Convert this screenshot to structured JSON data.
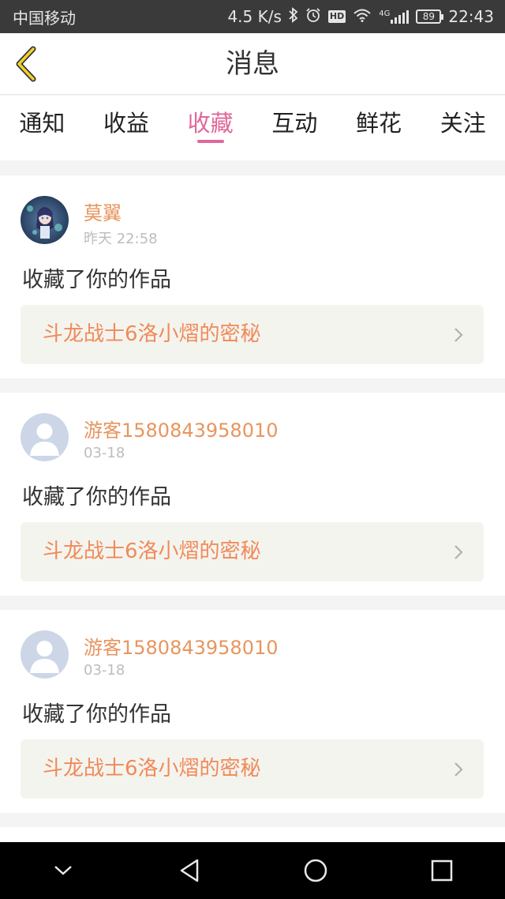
{
  "status_bar": {
    "carrier": "中国移动",
    "net_speed": "4.5 K/s",
    "battery": "89",
    "time": "22:43",
    "network_label": "4G",
    "hd_label": "HD"
  },
  "header": {
    "title": "消息",
    "accent_color": "#e0679b"
  },
  "tabs": [
    {
      "label": "通知",
      "active": false
    },
    {
      "label": "收益",
      "active": false
    },
    {
      "label": "收藏",
      "active": true
    },
    {
      "label": "互动",
      "active": false
    },
    {
      "label": "鲜花",
      "active": false
    },
    {
      "label": "关注",
      "active": false
    }
  ],
  "messages": [
    {
      "username": "莫翼",
      "time": "昨天 22:58",
      "action": "收藏了你的作品",
      "work_title": "斗龙战士6洛小熠的密秘",
      "avatar": "anime-avatar"
    },
    {
      "username": "游客1580843958010",
      "time": "03-18",
      "action": "收藏了你的作品",
      "work_title": "斗龙战士6洛小熠的密秘",
      "avatar": "default-avatar"
    },
    {
      "username": "游客1580843958010",
      "time": "03-18",
      "action": "收藏了你的作品",
      "work_title": "斗龙战士6洛小熠的密秘",
      "avatar": "default-avatar"
    }
  ],
  "nav_bar": {
    "icons": [
      "collapse-icon",
      "back-triangle-icon",
      "home-circle-icon",
      "recents-square-icon"
    ]
  }
}
